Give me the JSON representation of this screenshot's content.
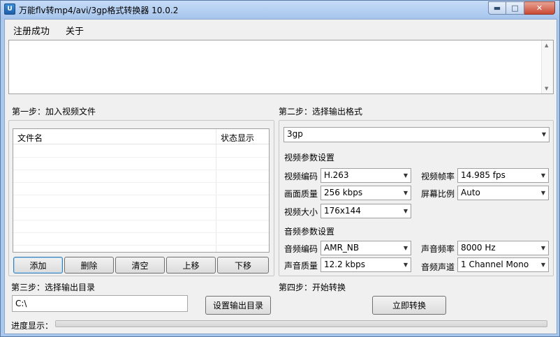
{
  "window": {
    "title": "万能flv转mp4/avi/3gp格式转换器 10.0.2",
    "icon_glyph": "U",
    "minimize_glyph": "▬",
    "maximize_glyph": "□",
    "close_glyph": "✕"
  },
  "menu": {
    "items": [
      {
        "label": "注册成功"
      },
      {
        "label": "关于"
      }
    ]
  },
  "log_text": "",
  "step1": {
    "title": "第一步：加入视频文件",
    "columns": [
      "文件名",
      "状态显示"
    ],
    "rows": [],
    "buttons": {
      "add": "添加",
      "delete": "删除",
      "clear": "清空",
      "move_up": "上移",
      "move_down": "下移"
    }
  },
  "step2": {
    "title": "第二步：选择输出格式",
    "format": "3gp",
    "video": {
      "section_title": "视频参数设置",
      "codec_label": "视频编码",
      "codec": "H.263",
      "framerate_label": "视频帧率",
      "framerate": "14.985 fps",
      "quality_label": "画面质量",
      "quality": "256 kbps",
      "aspect_label": "屏幕比例",
      "aspect": "Auto",
      "size_label": "视频大小",
      "size": "176x144"
    },
    "audio": {
      "section_title": "音频参数设置",
      "codec_label": "音频编码",
      "codec": "AMR_NB",
      "samplerate_label": "声音频率",
      "samplerate": "8000 Hz",
      "quality_label": "声音质量",
      "quality": "12.2 kbps",
      "channels_label": "音频声道",
      "channels": "1 Channel Mono"
    }
  },
  "step3": {
    "title": "第三步：选择输出目录",
    "output_dir": "C:\\",
    "set_dir_button": "设置输出目录"
  },
  "step4": {
    "title": "第四步：开始转换",
    "convert_button": "立即转换"
  },
  "progress": {
    "label": "进度显示：",
    "value": 0
  },
  "dropdown_arrow": "▼",
  "colors": {
    "title_bar": "#b4cff2",
    "close_button": "#c94a35",
    "progress_fill": "#06b025"
  }
}
